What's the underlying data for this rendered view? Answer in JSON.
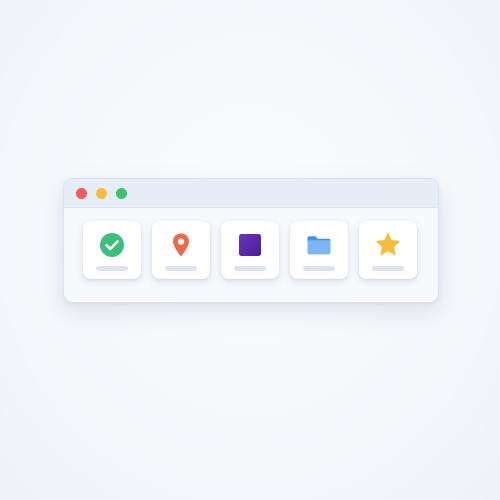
{
  "window": {
    "controls": [
      {
        "name": "close",
        "color": "#ef5a5a"
      },
      {
        "name": "minimize",
        "color": "#f5bf3c"
      },
      {
        "name": "maximize",
        "color": "#3cc46b"
      }
    ]
  },
  "toolbar": {
    "tiles": [
      {
        "icon": "check-circle-icon",
        "color": "#3cbf7c"
      },
      {
        "icon": "map-pin-icon",
        "color": "#ec6a4a"
      },
      {
        "icon": "square-icon",
        "color": "#5b2aa8"
      },
      {
        "icon": "folder-icon",
        "color": "#5aa0ee"
      },
      {
        "icon": "star-icon",
        "color": "#f6bd3a"
      }
    ]
  }
}
